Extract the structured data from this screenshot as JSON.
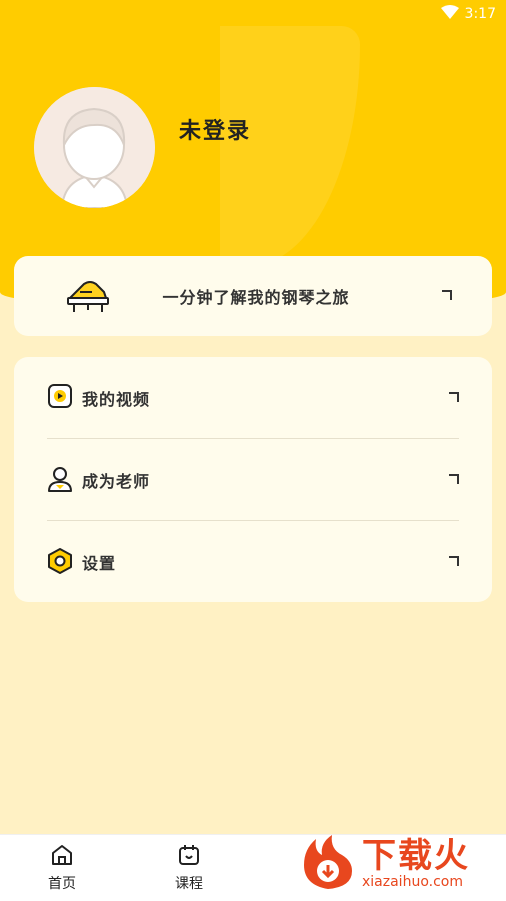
{
  "status_bar": {
    "time": "3:17"
  },
  "profile": {
    "username": "未登录"
  },
  "intro": {
    "label": "一分钟了解我的钢琴之旅"
  },
  "menu": {
    "items": [
      {
        "label": "我的视频",
        "icon": "video-icon"
      },
      {
        "label": "成为老师",
        "icon": "user-icon"
      },
      {
        "label": "设置",
        "icon": "settings-icon"
      }
    ]
  },
  "tabbar": {
    "tabs": [
      {
        "label": "首页",
        "icon": "home-icon"
      },
      {
        "label": "课程",
        "icon": "calendar-icon"
      }
    ]
  },
  "watermark": {
    "title": "下载火",
    "subtitle": "xiazaihuo.com"
  },
  "colors": {
    "header": "#FFCC00",
    "background": "#FFF1C4",
    "card": "#FFFCEC",
    "watermark": "#E8471E"
  }
}
